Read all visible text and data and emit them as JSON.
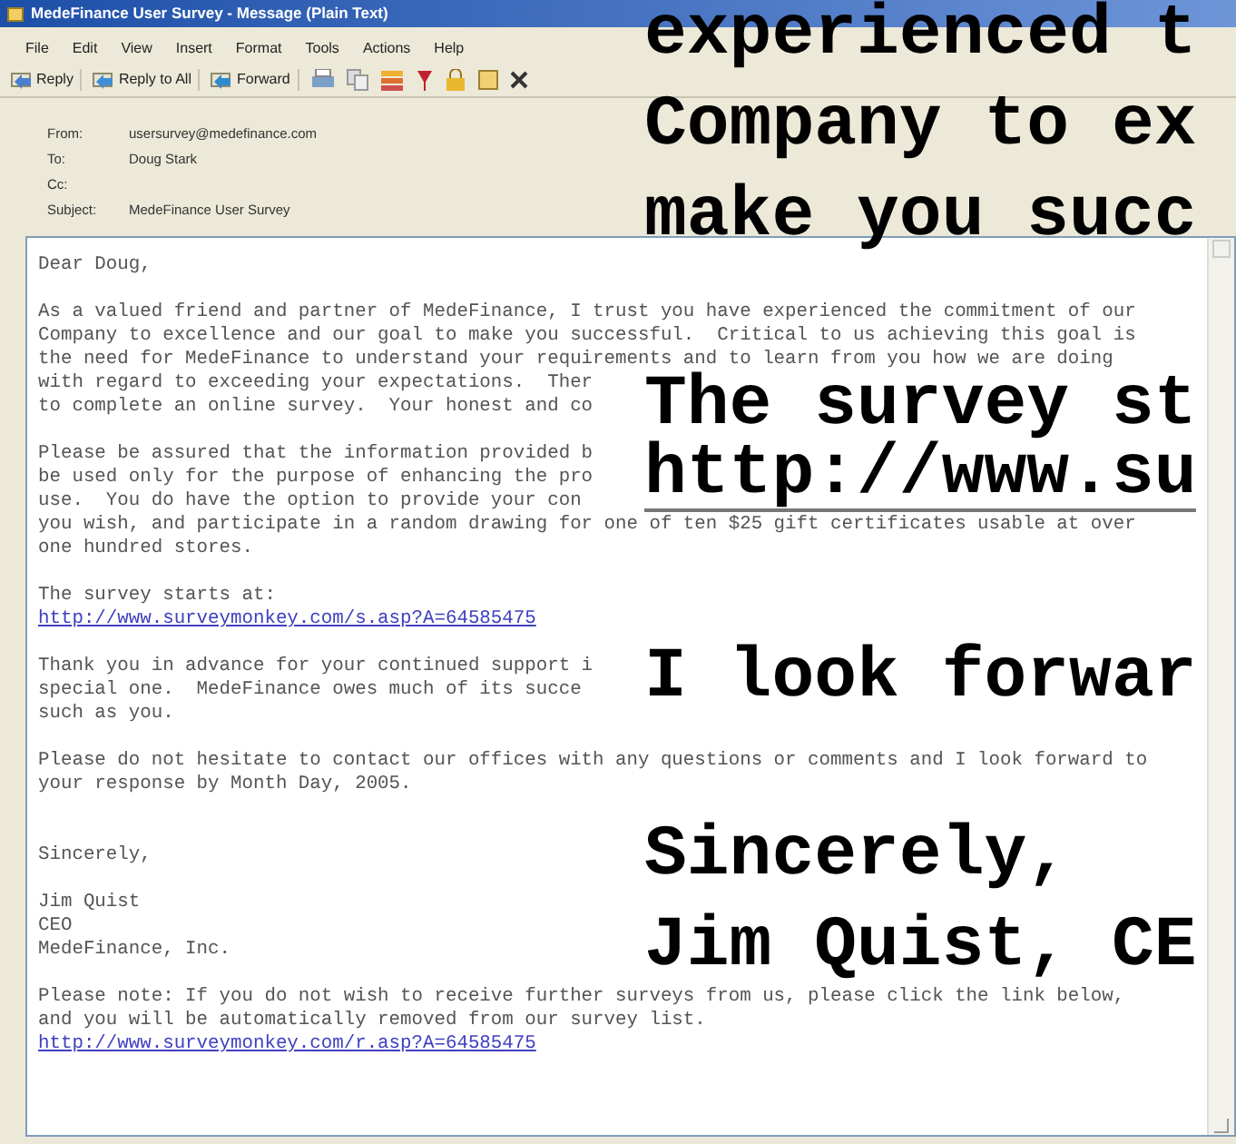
{
  "window": {
    "title": "MedeFinance User Survey - Message (Plain Text)"
  },
  "menu": [
    {
      "label": "File"
    },
    {
      "label": "Edit"
    },
    {
      "label": "View"
    },
    {
      "label": "Insert"
    },
    {
      "label": "Format"
    },
    {
      "label": "Tools"
    },
    {
      "label": "Actions"
    },
    {
      "label": "Help"
    }
  ],
  "toolbar": [
    {
      "label": "Reply",
      "kind": "reply"
    },
    {
      "label": "Reply to All",
      "kind": "reply_all"
    },
    {
      "label": "Forward",
      "kind": "forward"
    }
  ],
  "header": [
    {
      "label": "From:",
      "value": "usersurvey@medefinance.com"
    },
    {
      "label": "To:",
      "value": "Doug Stark"
    },
    {
      "label": "Cc:"
    },
    {
      "label": "Subject:",
      "value": "MedeFinance User Survey"
    }
  ],
  "body": [
    {
      "kind": "text",
      "text": "Dear Doug,"
    },
    {
      "kind": "blank"
    },
    {
      "kind": "text",
      "text": "As a valued friend and partner of MedeFinance, I trust you have experienced the commitment of our"
    },
    {
      "kind": "text",
      "text": "Company to excellence and our goal to make you successful.  Critical to us achieving this goal is"
    },
    {
      "kind": "text",
      "text": "the need for MedeFinance to understand your requirements and to learn from you how we are doing"
    },
    {
      "kind": "text",
      "text": "with regard to exceeding your expectations.  Ther"
    },
    {
      "kind": "text",
      "text": "to complete an online survey.  Your honest and co"
    },
    {
      "kind": "blank"
    },
    {
      "kind": "text",
      "text": "Please be assured that the information provided b"
    },
    {
      "kind": "text",
      "text": "be used only for the purpose of enhancing the pro"
    },
    {
      "kind": "text",
      "text": "use.  You do have the option to provide your con"
    },
    {
      "kind": "text",
      "text": "you wish, and participate in a random drawing for one of ten $25 gift certificates usable at over"
    },
    {
      "kind": "text",
      "text": "one hundred stores."
    },
    {
      "kind": "blank"
    },
    {
      "kind": "text",
      "text": "The survey starts at:"
    },
    {
      "kind": "link",
      "text": "http://www.surveymonkey.com/s.asp?A=64585475"
    },
    {
      "kind": "blank"
    },
    {
      "kind": "text",
      "text": "Thank you in advance for your continued support i"
    },
    {
      "kind": "text",
      "text": "special one.  MedeFinance owes much of its succe"
    },
    {
      "kind": "text",
      "text": "such as you."
    },
    {
      "kind": "blank"
    },
    {
      "kind": "text",
      "text": "Please do not hesitate to contact our offices with any questions or comments and I look forward to"
    },
    {
      "kind": "text",
      "text": "your response by Month Day, 2005."
    },
    {
      "kind": "blank"
    },
    {
      "kind": "blank"
    },
    {
      "kind": "text",
      "text": "Sincerely,"
    },
    {
      "kind": "blank"
    },
    {
      "kind": "text",
      "text": "Jim Quist"
    },
    {
      "kind": "text",
      "text": "CEO"
    },
    {
      "kind": "text",
      "text": "MedeFinance, Inc."
    },
    {
      "kind": "blank"
    },
    {
      "kind": "text",
      "text": "Please note: If you do not wish to receive further surveys from us, please click the link below,"
    },
    {
      "kind": "text",
      "text": "and you will be automatically removed from our survey list."
    },
    {
      "kind": "link",
      "text": "http://www.surveymonkey.com/r.asp?A=64585475"
    }
  ],
  "overlay": [
    {
      "kind": "text",
      "text": "experienced t"
    },
    {
      "kind": "text",
      "text": "Company to ex"
    },
    {
      "kind": "text",
      "text": "make you succ"
    },
    {
      "kind": "blank"
    },
    {
      "kind": "text",
      "text": "The survey st"
    },
    {
      "kind": "link",
      "text": "http://www.su"
    },
    {
      "kind": "blank"
    },
    {
      "kind": "text",
      "text": "I look forwar"
    },
    {
      "kind": "blank"
    },
    {
      "kind": "text",
      "text": "Sincerely,"
    },
    {
      "kind": "text",
      "text": "Jim Quist, CE"
    }
  ]
}
